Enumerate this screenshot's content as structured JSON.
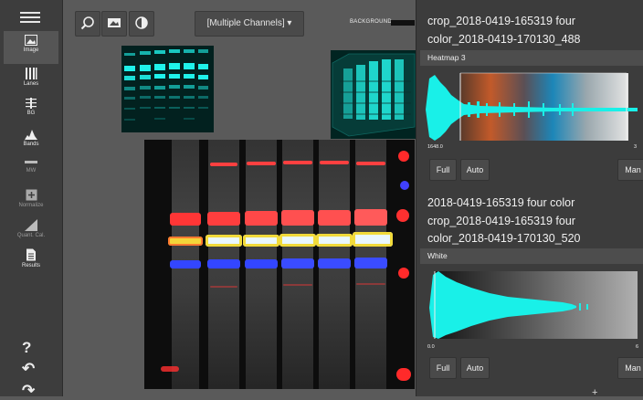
{
  "sidebar": {
    "items": [
      {
        "label": "Image",
        "icon": "image-icon"
      },
      {
        "label": "Lanes",
        "icon": "lanes-icon"
      },
      {
        "label": "BG",
        "icon": "background-icon"
      },
      {
        "label": "Bands",
        "icon": "bands-icon"
      },
      {
        "label": "MW",
        "icon": "molecular-weight-icon"
      },
      {
        "label": "Normalize",
        "icon": "normalize-icon"
      },
      {
        "label": "Quant. Cal.",
        "icon": "quant-cal-icon"
      },
      {
        "label": "Results",
        "icon": "results-icon"
      }
    ],
    "help": "?",
    "undo": "↶",
    "redo": "↷"
  },
  "toolbar": {
    "channel_select": "[Multiple Channels] ▾",
    "background_label": "BACKGROUND"
  },
  "panel": {
    "top_title_line1": "crop_2018-0419-165319 four",
    "top_title_line2": "color_2018-0419-170130_488",
    "section1": {
      "name": "Heatmap 3",
      "min_label": "1648.0",
      "max_label": "3",
      "buttons": {
        "full": "Full",
        "auto": "Auto",
        "manual": "Man"
      }
    },
    "second_title_line1": "2018-0419-165319 four color",
    "second_title_line2": "crop_2018-0419-165319 four",
    "second_title_line3": "color_2018-0419-170130_520",
    "section2": {
      "name": "White",
      "min_label": "0.0",
      "max_label": "6",
      "buttons": {
        "full": "Full",
        "auto": "Auto",
        "manual": "Man"
      }
    },
    "plus": "+"
  },
  "colors": {
    "cyan": "#19f0e8",
    "red": "#ff3b3b",
    "blue": "#2f4cff",
    "yellow": "#f2e13a"
  }
}
